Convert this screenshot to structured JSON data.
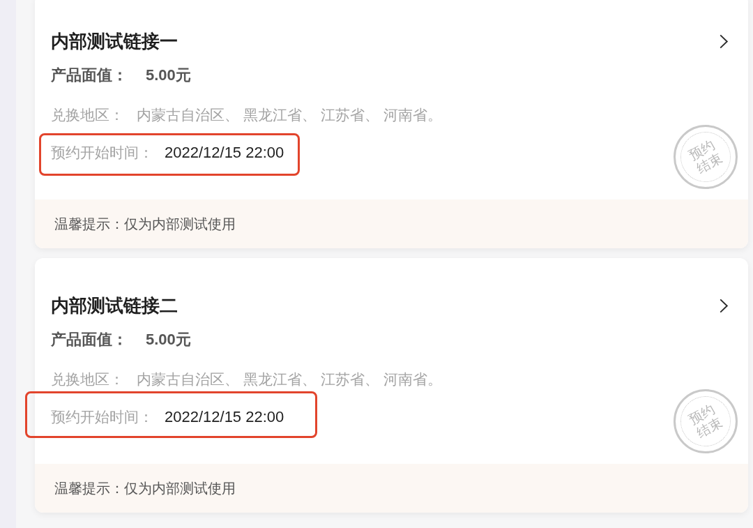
{
  "cards": [
    {
      "title": "内部测试链接一",
      "face_value": {
        "label": "产品面值：",
        "value": "5.00元"
      },
      "regions": {
        "label": "兑换地区：",
        "value": "内蒙古自治区、 黑龙江省、 江苏省、 河南省。"
      },
      "start_time": {
        "label": "预约开始时间：",
        "value": "2022/12/15 22:00",
        "highlighted": true
      },
      "stamp": "预约结束",
      "tip": "温馨提示：仅为内部测试使用"
    },
    {
      "title": "内部测试链接二",
      "face_value": {
        "label": "产品面值：",
        "value": "5.00元"
      },
      "regions": {
        "label": "兑换地区：",
        "value": "内蒙古自治区、 黑龙江省、 江苏省、 河南省。"
      },
      "start_time": {
        "label": "预约开始时间：",
        "value": "2022/12/15 22:00",
        "highlighted": true
      },
      "stamp": "预约结束",
      "tip": "温馨提示：仅为内部测试使用"
    }
  ]
}
